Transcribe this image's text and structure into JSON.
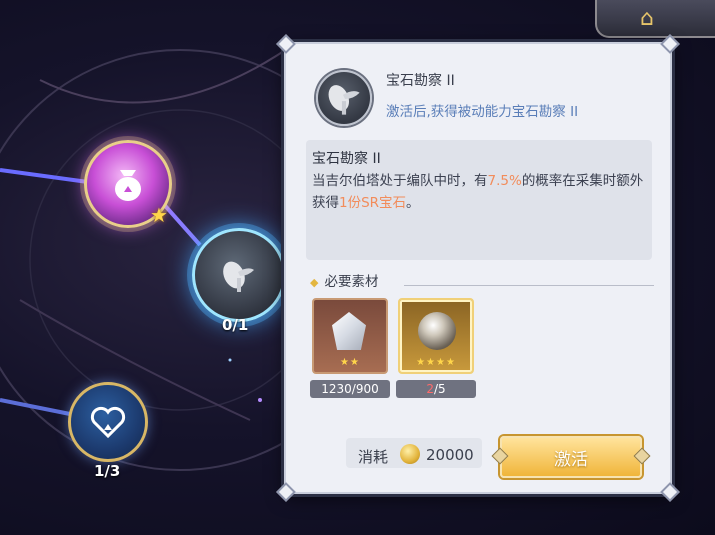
{
  "tree": {
    "gem_node_progress": "0/1",
    "heart_node_progress": "1/3"
  },
  "top_tab": {
    "icon": "home-icon"
  },
  "panel": {
    "skill_name": "宝石勘察 II",
    "skill_subtitle": "激活后,获得被动能力宝石勘察 II",
    "desc_title": "宝石勘察 II",
    "desc_part1": "当吉尔伯塔处于编队中时，有",
    "desc_highlight1": "7.5%",
    "desc_part2": "的概率在采集时额外获得",
    "desc_highlight2": "1份SR宝石",
    "desc_part3": "。",
    "materials_header": "必要素材",
    "materials": [
      {
        "icon": "crystal-icon",
        "stars": "★★",
        "owned": "1230",
        "sep": "/",
        "required": "900"
      },
      {
        "icon": "orb-icon",
        "stars": "★★★★",
        "owned": "2",
        "sep": "/",
        "required": "5"
      }
    ],
    "cost_label": "消耗",
    "cost_value": "20000",
    "activate_label": "激活"
  },
  "colors": {
    "highlight": "#f28c5b",
    "insufficient": "#ff6a6a",
    "accent_gold": "#f0b53a"
  }
}
